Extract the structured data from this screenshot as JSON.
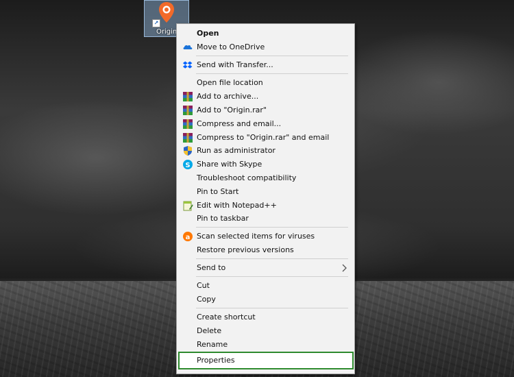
{
  "desktop_icon": {
    "label": "Origin",
    "icon": "origin-pin-icon",
    "accent": "#f26a29"
  },
  "menu": {
    "items": [
      {
        "label": "Open",
        "icon": ""
      },
      {
        "label": "Move to OneDrive",
        "icon": "onedrive-icon"
      },
      {
        "label": "Send with Transfer...",
        "icon": "dropbox-icon"
      },
      {
        "label": "Open file location",
        "icon": ""
      },
      {
        "label": "Add to archive...",
        "icon": "winrar-icon"
      },
      {
        "label": "Add to \"Origin.rar\"",
        "icon": "winrar-icon"
      },
      {
        "label": "Compress and email...",
        "icon": "winrar-icon"
      },
      {
        "label": "Compress to \"Origin.rar\" and email",
        "icon": "winrar-icon"
      },
      {
        "label": "Run as administrator",
        "icon": "uac-shield-icon"
      },
      {
        "label": "Share with Skype",
        "icon": "skype-icon"
      },
      {
        "label": "Troubleshoot compatibility",
        "icon": ""
      },
      {
        "label": "Pin to Start",
        "icon": ""
      },
      {
        "label": "Edit with Notepad++",
        "icon": "notepadpp-icon"
      },
      {
        "label": "Pin to taskbar",
        "icon": ""
      },
      {
        "label": "Scan selected items for viruses",
        "icon": "avast-icon"
      },
      {
        "label": "Restore previous versions",
        "icon": ""
      },
      {
        "label": "Send to",
        "icon": "chevron-right-icon"
      },
      {
        "label": "Cut",
        "icon": ""
      },
      {
        "label": "Copy",
        "icon": ""
      },
      {
        "label": "Create shortcut",
        "icon": ""
      },
      {
        "label": "Delete",
        "icon": ""
      },
      {
        "label": "Rename",
        "icon": ""
      },
      {
        "label": "Properties",
        "icon": ""
      }
    ],
    "highlight_color": "#2e8b2e"
  }
}
